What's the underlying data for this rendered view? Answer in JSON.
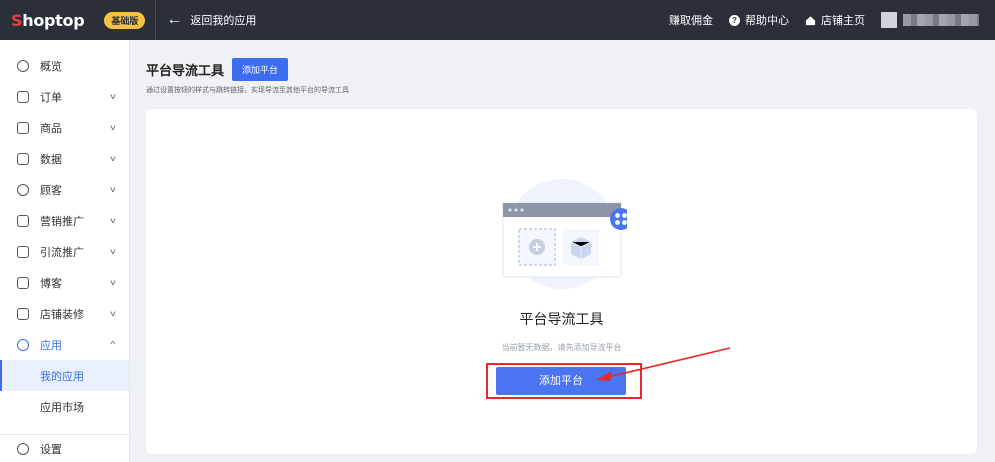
{
  "topbar": {
    "logo_first": "S",
    "logo_rest": "hoptop",
    "plan_badge": "基础版",
    "back_label": "返回我的应用",
    "earn_label": "赚取佣金",
    "help_label": "帮助中心",
    "store_label": "店铺主页"
  },
  "sidebar": {
    "items": [
      {
        "label": "概览"
      },
      {
        "label": "订单"
      },
      {
        "label": "商品"
      },
      {
        "label": "数据"
      },
      {
        "label": "顾客"
      },
      {
        "label": "营销推广"
      },
      {
        "label": "引流推广"
      },
      {
        "label": "博客"
      },
      {
        "label": "店铺装修"
      },
      {
        "label": "应用"
      }
    ],
    "sub_items": [
      {
        "label": "我的应用"
      },
      {
        "label": "应用市场"
      }
    ],
    "bottom_label": "设置"
  },
  "page": {
    "title": "平台导流工具",
    "add_button": "添加平台",
    "description": "通过设置按钮的样式与跳转链接，实现导流至其他平台的导流工具"
  },
  "empty_state": {
    "title": "平台导流工具",
    "description": "当前暂无数据，请先添加导流平台",
    "button": "添加平台"
  },
  "colors": {
    "topbar_bg": "#2b2f3a",
    "accent": "#3b6df0",
    "annotation_red": "#e52a2a"
  }
}
